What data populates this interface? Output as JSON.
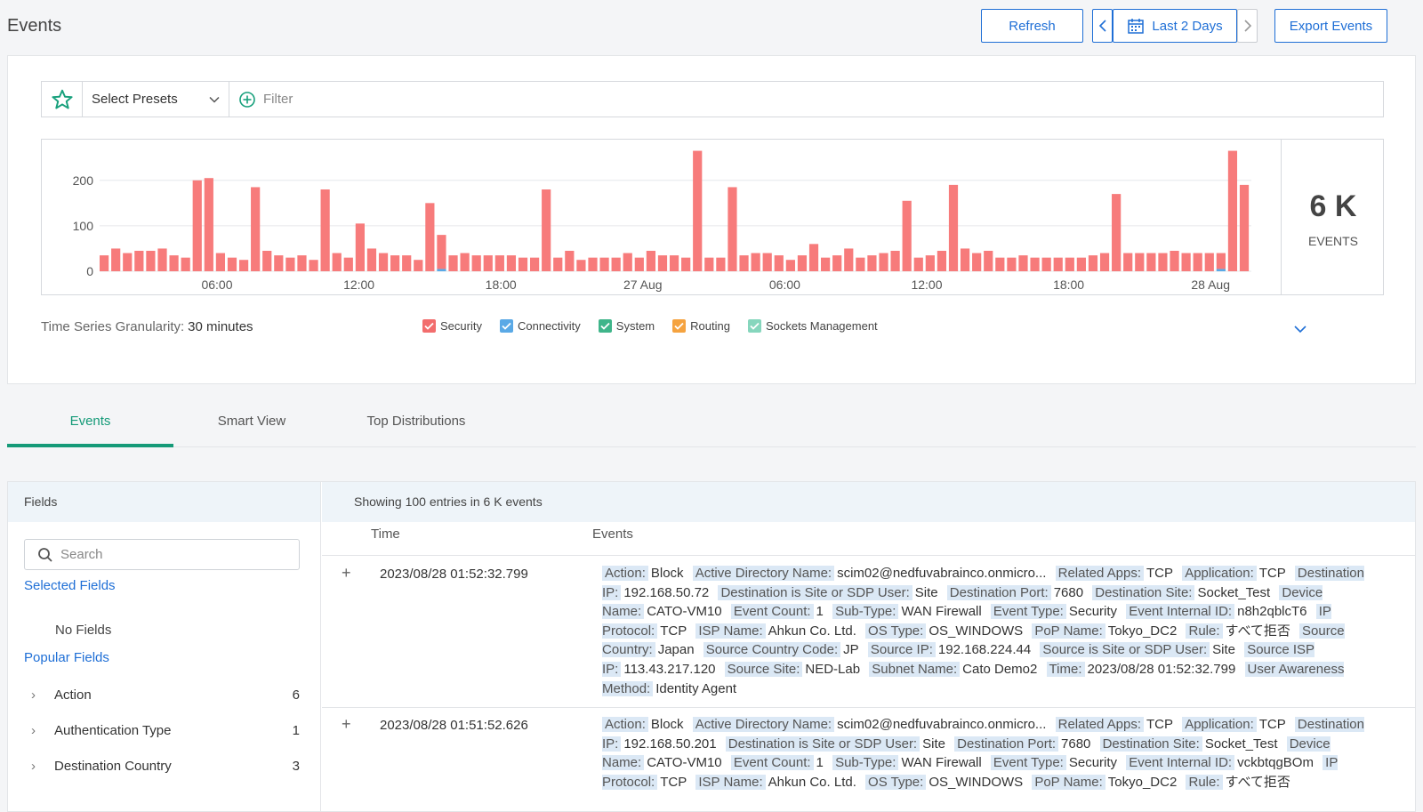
{
  "header": {
    "title": "Events",
    "refresh_label": "Refresh",
    "range_label": "Last 2 Days",
    "export_label": "Export Events"
  },
  "filter": {
    "presets_label": "Select Presets",
    "filter_placeholder": "Filter"
  },
  "summary": {
    "total": "6 K",
    "total_label": "EVENTS",
    "granularity_label": "Time Series Granularity:",
    "granularity_value": "30 minutes"
  },
  "legend": [
    {
      "label": "Security",
      "color": "#f26d6d"
    },
    {
      "label": "Connectivity",
      "color": "#5aa9e6"
    },
    {
      "label": "System",
      "color": "#3fb58a"
    },
    {
      "label": "Routing",
      "color": "#f5a340"
    },
    {
      "label": "Sockets Management",
      "color": "#86d6bd"
    }
  ],
  "chart_data": {
    "type": "bar",
    "ylim": [
      0,
      270
    ],
    "y_ticks": [
      "0",
      "100",
      "200"
    ],
    "x_tick_labels": [
      "06:00",
      "12:00",
      "18:00",
      "27 Aug",
      "06:00",
      "12:00",
      "18:00",
      "28 Aug"
    ],
    "series": [
      {
        "name": "Security",
        "values": [
          35,
          50,
          40,
          45,
          45,
          50,
          35,
          30,
          200,
          205,
          40,
          30,
          25,
          185,
          45,
          35,
          30,
          35,
          25,
          180,
          40,
          30,
          105,
          50,
          40,
          35,
          35,
          25,
          150,
          75,
          35,
          40,
          35,
          35,
          35,
          35,
          30,
          30,
          180,
          30,
          45,
          25,
          30,
          30,
          30,
          40,
          30,
          45,
          35,
          35,
          30,
          265,
          30,
          30,
          185,
          35,
          40,
          40,
          35,
          25,
          35,
          60,
          30,
          35,
          50,
          30,
          35,
          40,
          45,
          155,
          30,
          35,
          45,
          190,
          50,
          40,
          45,
          30,
          30,
          35,
          30,
          30,
          30,
          30,
          30,
          35,
          40,
          170,
          40,
          40,
          40,
          40,
          45,
          40,
          40,
          40,
          35,
          265,
          190
        ]
      },
      {
        "name": "Connectivity",
        "values": [
          0,
          0,
          0,
          0,
          0,
          0,
          0,
          0,
          0,
          0,
          0,
          0,
          0,
          0,
          0,
          0,
          0,
          0,
          0,
          0,
          0,
          0,
          0,
          0,
          0,
          0,
          0,
          0,
          0,
          5,
          0,
          0,
          0,
          0,
          0,
          0,
          0,
          0,
          0,
          0,
          0,
          0,
          0,
          0,
          0,
          0,
          0,
          0,
          0,
          0,
          0,
          0,
          0,
          0,
          0,
          0,
          0,
          0,
          0,
          0,
          0,
          0,
          0,
          0,
          0,
          0,
          0,
          0,
          0,
          0,
          0,
          0,
          0,
          0,
          0,
          0,
          0,
          0,
          0,
          0,
          0,
          0,
          0,
          0,
          0,
          0,
          0,
          0,
          0,
          0,
          0,
          0,
          0,
          0,
          0,
          0,
          5,
          0,
          0
        ]
      }
    ],
    "visible_events": [
      {
        "time": "2023/08/28 01:52:32.799",
        "fields": [
          [
            "Action:",
            "Block"
          ],
          [
            "Active Directory Name:",
            "scim02@nedfuvabrainco.onmicro..."
          ],
          [
            "Related Apps:",
            "TCP"
          ],
          [
            "Application:",
            "TCP"
          ],
          [
            "Destination IP:",
            "192.168.50.72"
          ],
          [
            "Destination is Site or SDP User:",
            "Site"
          ],
          [
            "Destination Port:",
            "7680"
          ],
          [
            "Destination Site:",
            "Socket_Test"
          ],
          [
            "Device Name:",
            "CATO-VM10"
          ],
          [
            "Event Count:",
            "1"
          ],
          [
            "Sub-Type:",
            "WAN Firewall"
          ],
          [
            "Event Type:",
            "Security"
          ],
          [
            "Event Internal ID:",
            "n8h2qblcT6"
          ],
          [
            "IP Protocol:",
            "TCP"
          ],
          [
            "ISP Name:",
            "Ahkun Co. Ltd."
          ],
          [
            "OS Type:",
            "OS_WINDOWS"
          ],
          [
            "PoP Name:",
            "Tokyo_DC2"
          ],
          [
            "Rule:",
            "すべて拒否"
          ],
          [
            "Source Country:",
            "Japan"
          ],
          [
            "Source Country Code:",
            "JP"
          ],
          [
            "Source IP:",
            "192.168.224.44"
          ],
          [
            "Source is Site or SDP User:",
            "Site"
          ],
          [
            "Source ISP IP:",
            "113.43.217.120"
          ],
          [
            "Source Site:",
            "NED-Lab"
          ],
          [
            "Subnet Name:",
            "Cato Demo2"
          ],
          [
            "Time:",
            "2023/08/28 01:52:32.799"
          ],
          [
            "User Awareness Method:",
            "Identity Agent"
          ]
        ]
      },
      {
        "time": "2023/08/28 01:51:52.626",
        "fields": [
          [
            "Action:",
            "Block"
          ],
          [
            "Active Directory Name:",
            "scim02@nedfuvabrainco.onmicro..."
          ],
          [
            "Related Apps:",
            "TCP"
          ],
          [
            "Application:",
            "TCP"
          ],
          [
            "Destination IP:",
            "192.168.50.201"
          ],
          [
            "Destination is Site or SDP User:",
            "Site"
          ],
          [
            "Destination Port:",
            "7680"
          ],
          [
            "Destination Site:",
            "Socket_Test"
          ],
          [
            "Device Name:",
            "CATO-VM10"
          ],
          [
            "Event Count:",
            "1"
          ],
          [
            "Sub-Type:",
            "WAN Firewall"
          ],
          [
            "Event Type:",
            "Security"
          ],
          [
            "Event Internal ID:",
            "vckbtqgBOm"
          ],
          [
            "IP Protocol:",
            "TCP"
          ],
          [
            "ISP Name:",
            "Ahkun Co. Ltd."
          ],
          [
            "OS Type:",
            "OS_WINDOWS"
          ],
          [
            "PoP Name:",
            "Tokyo_DC2"
          ],
          [
            "Rule:",
            "すべて拒否"
          ]
        ]
      }
    ]
  },
  "tabs": [
    {
      "label": "Events"
    },
    {
      "label": "Smart View"
    },
    {
      "label": "Top Distributions"
    }
  ],
  "fields_panel": {
    "title": "Fields",
    "search_placeholder": "Search",
    "selected_title": "Selected Fields",
    "no_fields": "No Fields",
    "popular_title": "Popular Fields",
    "popular": [
      {
        "name": "Action",
        "count": "6"
      },
      {
        "name": "Authentication Type",
        "count": "1"
      },
      {
        "name": "Destination Country",
        "count": "3"
      }
    ]
  },
  "table": {
    "showing": "Showing 100 entries in 6 K events",
    "col_time": "Time",
    "col_events": "Events"
  }
}
